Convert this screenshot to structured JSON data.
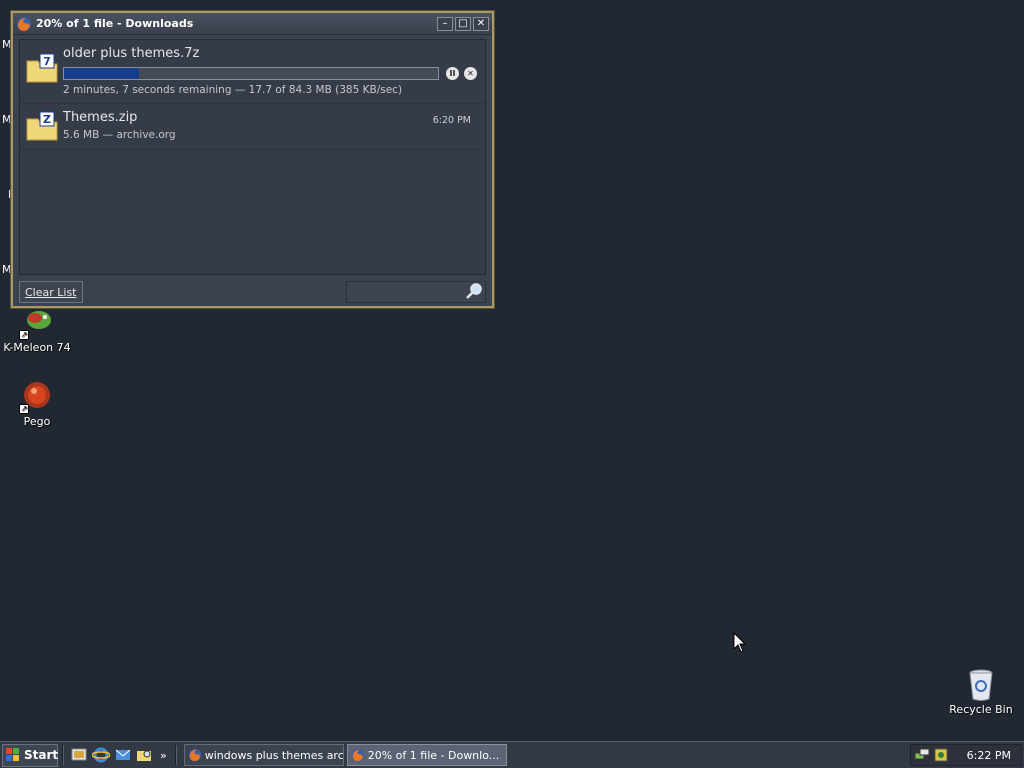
{
  "window": {
    "title": "20% of 1 file - Downloads",
    "controls": {
      "minimize": "–",
      "maximize": "□",
      "close": "✕"
    }
  },
  "downloads": [
    {
      "name": "older plus themes.7z",
      "progress_percent": 20,
      "status": "2 minutes, 7 seconds remaining — 17.7 of 84.3 MB (385 KB/sec)",
      "icon": "7z-archive-icon",
      "pause_label": "II",
      "cancel_label": "✕"
    },
    {
      "name": "Themes.zip",
      "status": "5.6 MB — archive.org",
      "time": "6:20 PM",
      "icon": "zip-archive-icon"
    }
  ],
  "footer": {
    "clear_list_label": "Clear List",
    "search_value": ""
  },
  "desktop": {
    "icons": [
      {
        "label": "K-Meleon 74",
        "icon": "k-meleon-icon"
      },
      {
        "label": "Pego",
        "icon": "pego-icon"
      },
      {
        "label": "Recycle Bin",
        "icon": "recycle-bin-icon"
      }
    ],
    "partial_letters": [
      "M",
      "M",
      "I",
      "M"
    ]
  },
  "taskbar": {
    "start_label": "Start",
    "quicklaunch_more": "»",
    "tasks": [
      {
        "label": "windows plus themes arc...",
        "active": false
      },
      {
        "label": "20% of 1 file - Downlo...",
        "active": true
      }
    ],
    "clock": "6:22 PM"
  },
  "colors": {
    "desktop_bg": "#222831",
    "window_border": "#a89a62",
    "progress_fill": "#173c8a"
  }
}
